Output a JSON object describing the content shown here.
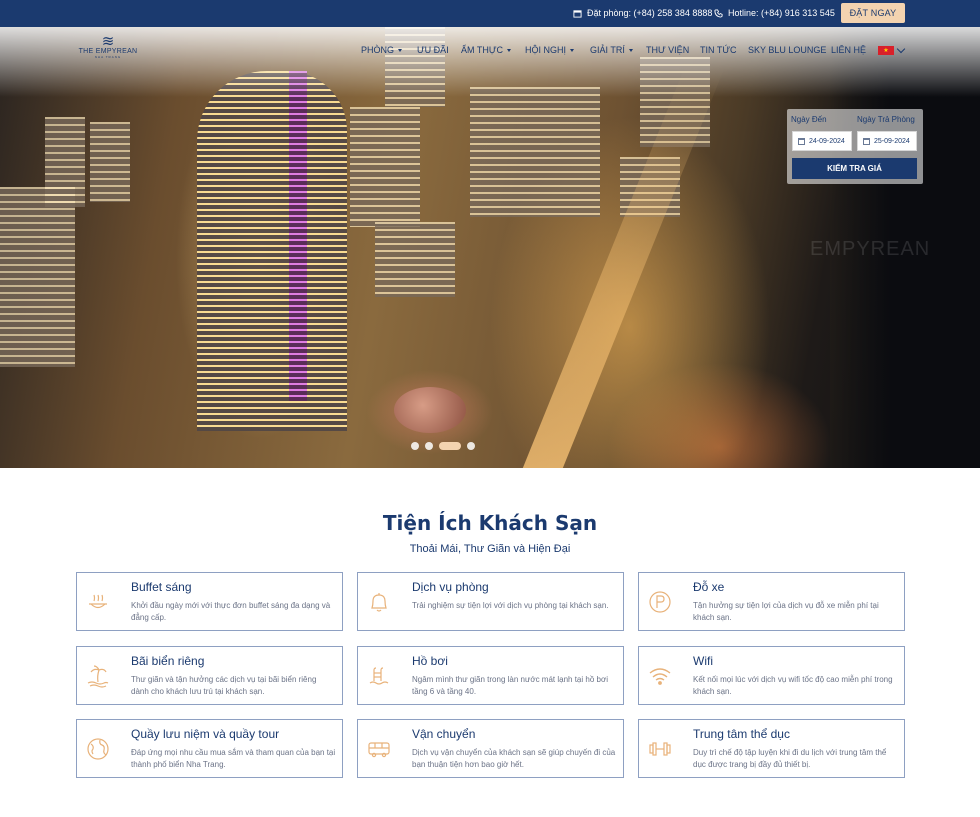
{
  "topbar": {
    "reservation": "Đặt phòng: (+84) 258 384 8888",
    "hotline": "Hotline: (+84) 916 313 545",
    "book_now": "ĐẶT NGAY"
  },
  "logo": {
    "name": "THE EMPYREAN",
    "sub": "NHA TRANG"
  },
  "nav": {
    "rooms": "PHÒNG",
    "offers": "ƯU ĐÃI",
    "dining": "ẨM THỰC",
    "meetings": "HỘI NGHỊ",
    "entertainment": "GIẢI TRÍ",
    "gallery": "THƯ VIỆN",
    "news": "TIN TỨC",
    "lounge": "SKY BLU LOUNGE",
    "contact": "LIÊN HỆ"
  },
  "booking": {
    "checkin_label": "Ngày Đến",
    "checkout_label": "Ngày Trả Phòng",
    "checkin_value": "24-09-2024",
    "checkout_value": "25-09-2024",
    "check_button": "KIỂM TRA GIÁ"
  },
  "hero": {
    "watermark": "EMPYREAN"
  },
  "amenities": {
    "title": "Tiện Ích Khách Sạn",
    "subtitle": "Thoải Mái, Thư Giãn và Hiện Đại",
    "items": [
      {
        "title": "Buffet sáng",
        "desc": "Khởi đầu ngày mới với thực đơn buffet sáng đa dạng và đẳng cấp.",
        "icon": "breakfast-icon"
      },
      {
        "title": "Dịch vụ phòng",
        "desc": "Trải nghiệm sự tiện lợi với dịch vụ phòng tại khách sạn.",
        "icon": "bell-icon"
      },
      {
        "title": "Đỗ xe",
        "desc": "Tận hưởng sự tiện lợi của dịch vụ đỗ xe miễn phí tại khách sạn.",
        "icon": "parking-icon"
      },
      {
        "title": "Bãi biển riêng",
        "desc": "Thư giãn và tận hưởng các dịch vụ tại bãi biển riêng dành cho khách lưu trú tại khách sạn.",
        "icon": "beach-icon"
      },
      {
        "title": "Hồ bơi",
        "desc": "Ngâm mình thư giãn trong làn nước mát lạnh tại hồ bơi tầng 6 và tầng 40.",
        "icon": "pool-icon"
      },
      {
        "title": "Wifi",
        "desc": "Kết nối mọi lúc với dịch vụ wifi tốc độ cao miễn phí trong khách sạn.",
        "icon": "wifi-icon"
      },
      {
        "title": "Quầy lưu niệm và quầy tour",
        "desc": "Đáp ứng mọi nhu cầu mua sắm và tham quan của bạn tại thành phố biển Nha Trang.",
        "icon": "globe-icon"
      },
      {
        "title": "Vận chuyển",
        "desc": "Dịch vụ vận chuyển của khách sạn sẽ giúp chuyến đi của bạn thuận tiện hơn bao giờ hết.",
        "icon": "bus-icon"
      },
      {
        "title": "Trung tâm thể dục",
        "desc": "Duy trì chế độ tập luyện khi đi du lịch với trung tâm thể dục được trang bị đầy đủ thiết bị.",
        "icon": "dumbbell-icon"
      }
    ]
  },
  "colors": {
    "navy": "#1b3a6f",
    "accent": "#f3d3b0",
    "icon": "#e8b27a"
  }
}
